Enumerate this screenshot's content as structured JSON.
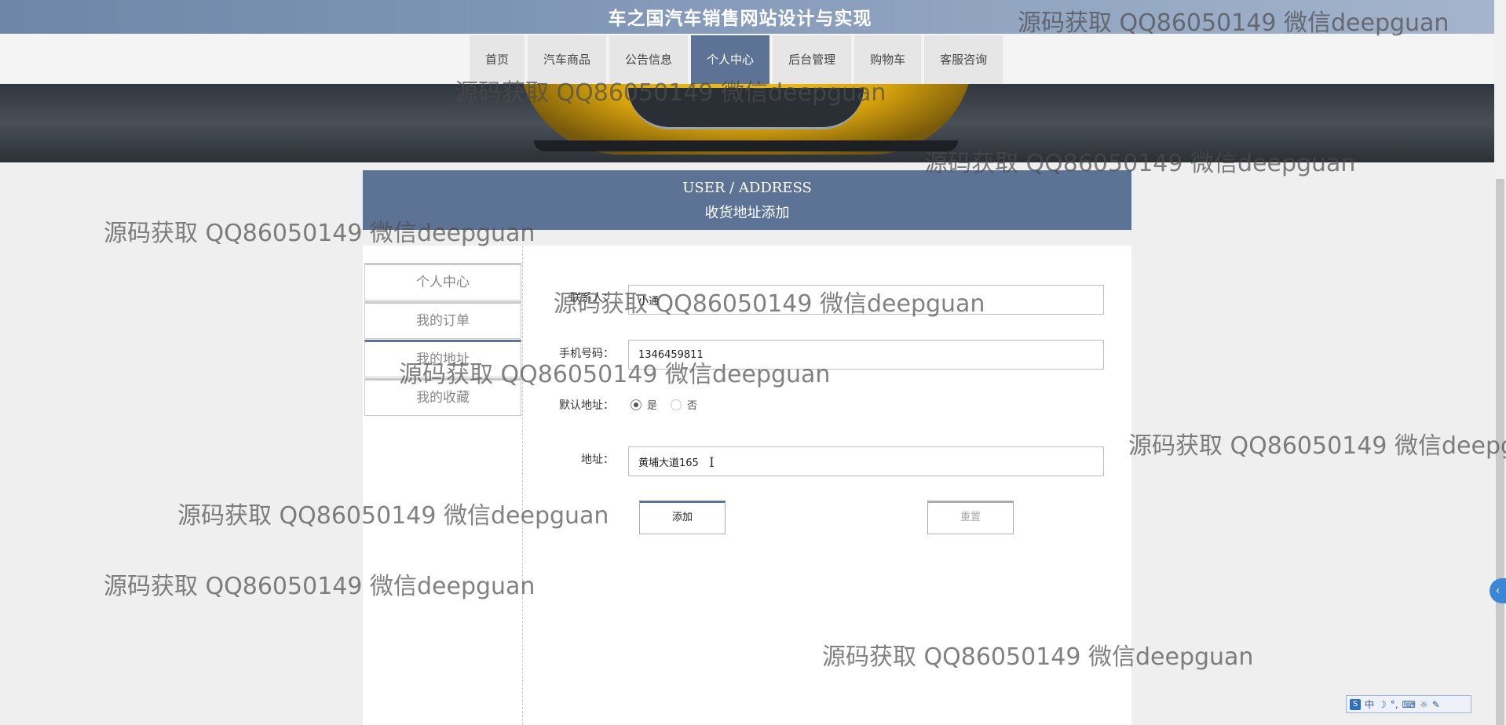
{
  "site": {
    "title": "车之国汽车销售网站设计与实现"
  },
  "nav": {
    "items": [
      "首页",
      "汽车商品",
      "公告信息",
      "个人中心",
      "后台管理",
      "购物车",
      "客服咨询"
    ],
    "active": "个人中心"
  },
  "section": {
    "title_en": "USER / ADDRESS",
    "title_cn": "收货地址添加"
  },
  "sidebar": {
    "items": [
      "个人中心",
      "我的订单",
      "我的地址",
      "我的收藏"
    ],
    "active": "我的地址"
  },
  "form": {
    "contact_label": "联系人：",
    "contact_value": "小通",
    "phone_label": "手机号码：",
    "phone_value": "1346459811",
    "default_label": "默认地址：",
    "default_yes": "是",
    "default_no": "否",
    "default_selected": "是",
    "address_label": "地址：",
    "address_value": "黄埔大道165",
    "add_button": "添加",
    "reset_button": "重置"
  },
  "watermark": {
    "text": "源码获取 QQ86050149 微信deepguan"
  },
  "ime": {
    "labels": [
      "中",
      "☽",
      "°,",
      "⌨",
      "☼",
      "✎"
    ]
  },
  "colors": {
    "accent": "#5c7395",
    "topbar": "#7f95b5",
    "background": "#efefef"
  }
}
